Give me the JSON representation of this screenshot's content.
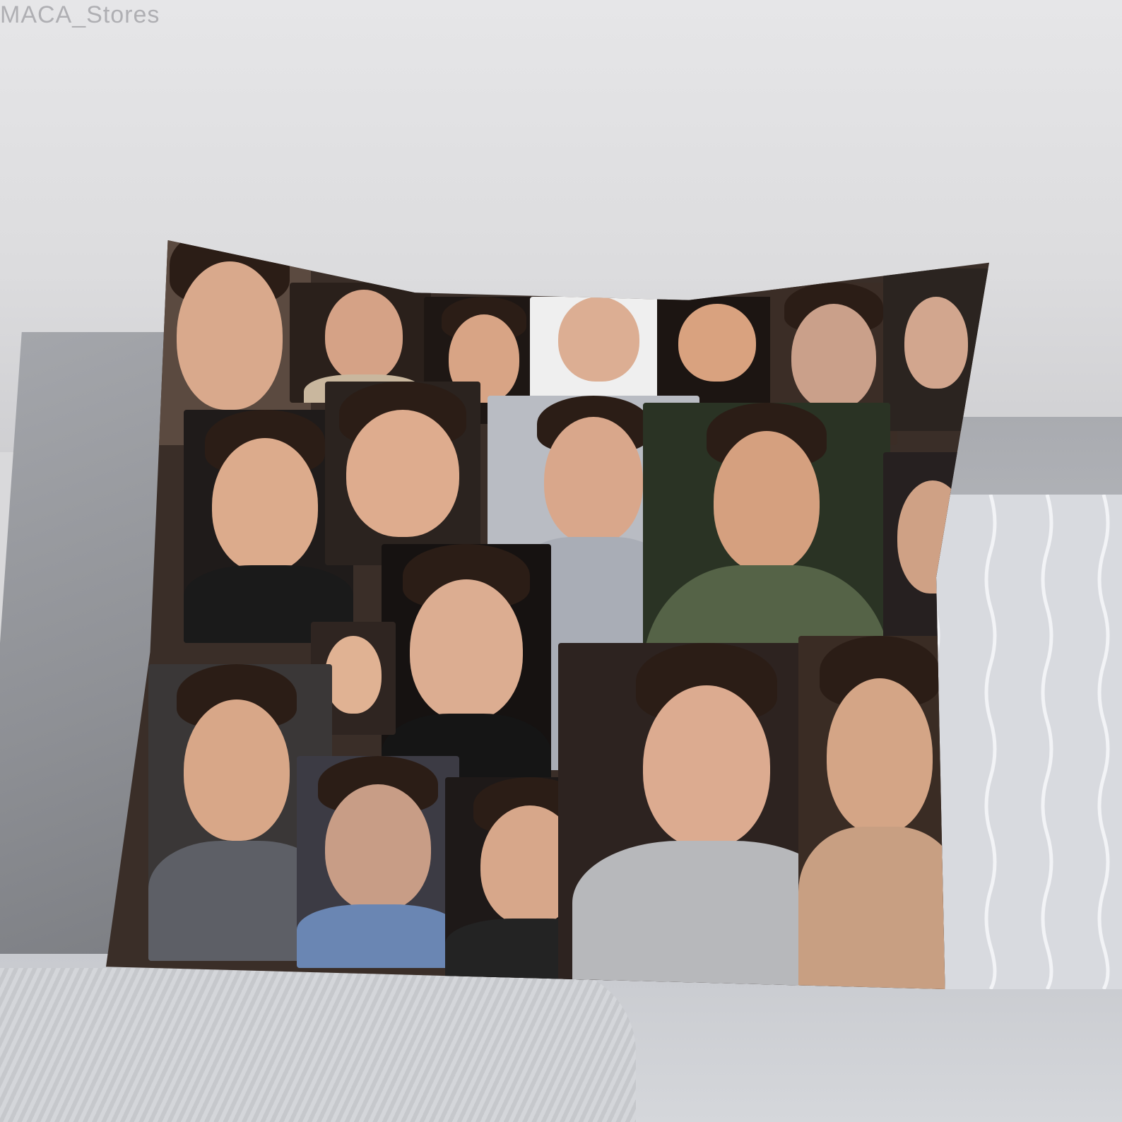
{
  "watermark": {
    "text": "MACA_Stores"
  },
  "scene": {
    "subject": "photo-collage-throw-pillow",
    "colors": {
      "wall": "#dcdcde",
      "sofa": "#b4b6bb",
      "pillow_dark": "#3a2e28"
    }
  }
}
